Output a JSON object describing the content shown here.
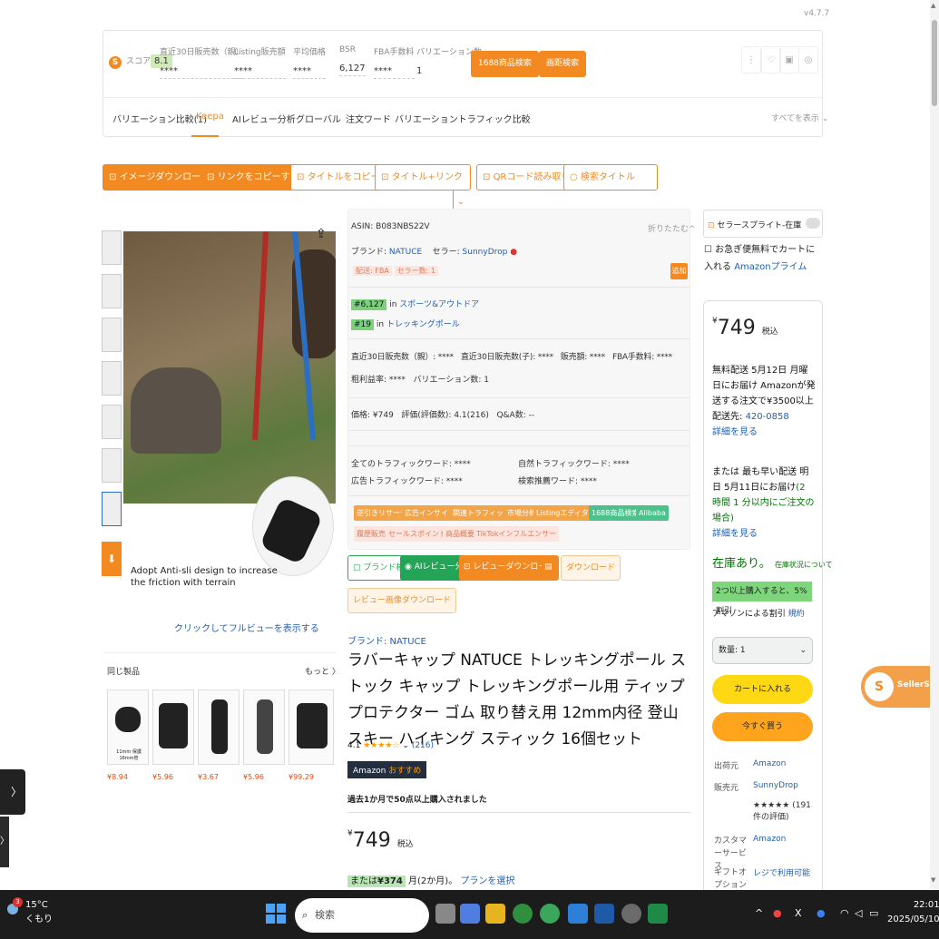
{
  "version": "v4.7.7",
  "stats": {
    "score_label": "スコア",
    "score_value": "8.1",
    "sales30_label": "直近30日販売数（親）",
    "sales30_value": "****",
    "listing_label": "Listing販売額",
    "listing_value": "****",
    "avgprice_label": "平均価格",
    "avgprice_value": "****",
    "bsr_label": "BSR",
    "bsr_value": "6,127",
    "fba_label": "FBA手数料",
    "fba_value": "****",
    "variation_label": "バリエーション数",
    "variation_value": "1",
    "btn_1688": "1688商品検索",
    "btn_img": "画距検索"
  },
  "tabs": [
    "バリエーション比較(1)",
    "Keepa",
    "AIレビュー分析",
    "グローバル",
    "注文ワード",
    "バリエーショントラフィック比較"
  ],
  "show_all": "すべてを表示",
  "actions": [
    "イメージダウンロード",
    "リンクをコピーする",
    "タイトルをコピー",
    "タイトル+リンク",
    "QRコード読み取り",
    "検索タイトル"
  ],
  "image_caption_1": "Adopt Anti-sli design to increase",
  "image_caption_2": "the friction with terrain",
  "zoom_link": "クリックしてフルビューを表示する",
  "similar": {
    "heading": "同じ製品",
    "more": "もっと",
    "prices": [
      "¥8.94",
      "¥5.96",
      "¥3.67",
      "¥5.96",
      "¥99.29"
    ],
    "card_text": "11mm 保護 16mm管"
  },
  "info": {
    "asin": "ASIN: B083NBS22V",
    "collapse": "折りたたむ",
    "brand_label": "ブランド:",
    "brand": "NATUCE",
    "seller_label": "セラー:",
    "seller": "SunnyDrop",
    "ship": "配送: FBA",
    "sellers": "セラー数: 1",
    "add": "追加",
    "rank1": "#6,127",
    "in": "in",
    "cat1": "スポーツ&アウトドア",
    "rank2": "#19",
    "cat2": "トレッキングポール",
    "m1": "直近30日販売数（親）: ****",
    "m2": "直近30日販売数(子): ****",
    "m3": "販売額: ****",
    "m4": "FBA手数料: ****",
    "m5": "粗利益率: ****",
    "m6": "バリエーション数: 1",
    "m7": "価格: ¥749",
    "m8": "評価(評価数): 4.1(216)",
    "m9": "Q&A数: --",
    "t1": "全てのトラフィックワード: ****",
    "t2": "自然トラフィックワード: ****",
    "t3": "広告トラフィックワード: ****",
    "t4": "検索推薦ワード: ****",
    "tags1": [
      "逆引きリサーチ",
      "広告インサイト",
      "関連トラフィック",
      "市場分析",
      "Listingエディター",
      "1688商品検索",
      "Alibaba"
    ],
    "tags2": [
      "履歴販売",
      "セールスポイント",
      "商品概要",
      "TikTokインフルエンサー"
    ]
  },
  "tool_buttons": [
    "ブランド検出",
    "AIレビュー分析",
    "レビューダウンロード",
    "ダウンロード",
    "レビュー画像ダウンロード"
  ],
  "product": {
    "brand_link": "ブランド: NATUCE",
    "title": "ラバーキャップ NATUCE トレッキングポール ストック キャップ トレッキングポール用 ティッププロテクター ゴム 取り替え用 12mm内径 登山 スキー ハイキング スティック 16個セット",
    "rating": "4.1",
    "stars": "★★★★☆",
    "review_count": "(216)",
    "choice_a": "Amazon",
    "choice_b": "おすすめ",
    "sold": "過去1か月で50点以上購入されました",
    "price_sym": "¥",
    "price": "749",
    "tax": "税込",
    "install_a": "または",
    "install_b": "¥374",
    "install_c": "月(2か月)。",
    "install_link": "プランを選択"
  },
  "buybox": {
    "sprite": "セラースプライト-在庫",
    "prime_a": "お急ぎ便無料でカートに入れる",
    "prime_b": "Amazonプライム",
    "price_sym": "¥",
    "price": "749",
    "tax": "税込",
    "deliv1": "無料配送 5月12日 月曜日にお届け Amazonが発送する注文で¥3500以上 配送先:",
    "deliv1_link": "420-0858",
    "details": "詳細を見る",
    "deliv2": "または 最も早い配送 明日 5月11日にお届け",
    "deliv2_g": "(2 時間 1 分以内にご注文の場合)",
    "stock": "在庫あり。",
    "stock_note": "在庫状況について",
    "discount": "2つ以上購入すると、5%割引",
    "discount_note": "アマゾンによる割引",
    "terms": "規約",
    "qty": "数量: 1",
    "cart": "カートに入れる",
    "buy": "今すぐ買う",
    "ship_from_k": "出荷元",
    "ship_from_v": "Amazon",
    "seller_k": "販売元",
    "seller_v": "SunnyDrop",
    "seller_stars": "★★★★★",
    "seller_reviews": "(191件の評価)",
    "cs_k": "カスタマーサービス",
    "cs_v": "Amazon",
    "gift_k": "ギフトオプション",
    "gift_v": "レジで利用可能"
  },
  "sellersprite_badge": "SellerSprite",
  "taskbar": {
    "temp": "15°C",
    "weather": "くもり",
    "badge": "3",
    "search": "検索",
    "time": "22:01",
    "date": "2025/05/10"
  }
}
